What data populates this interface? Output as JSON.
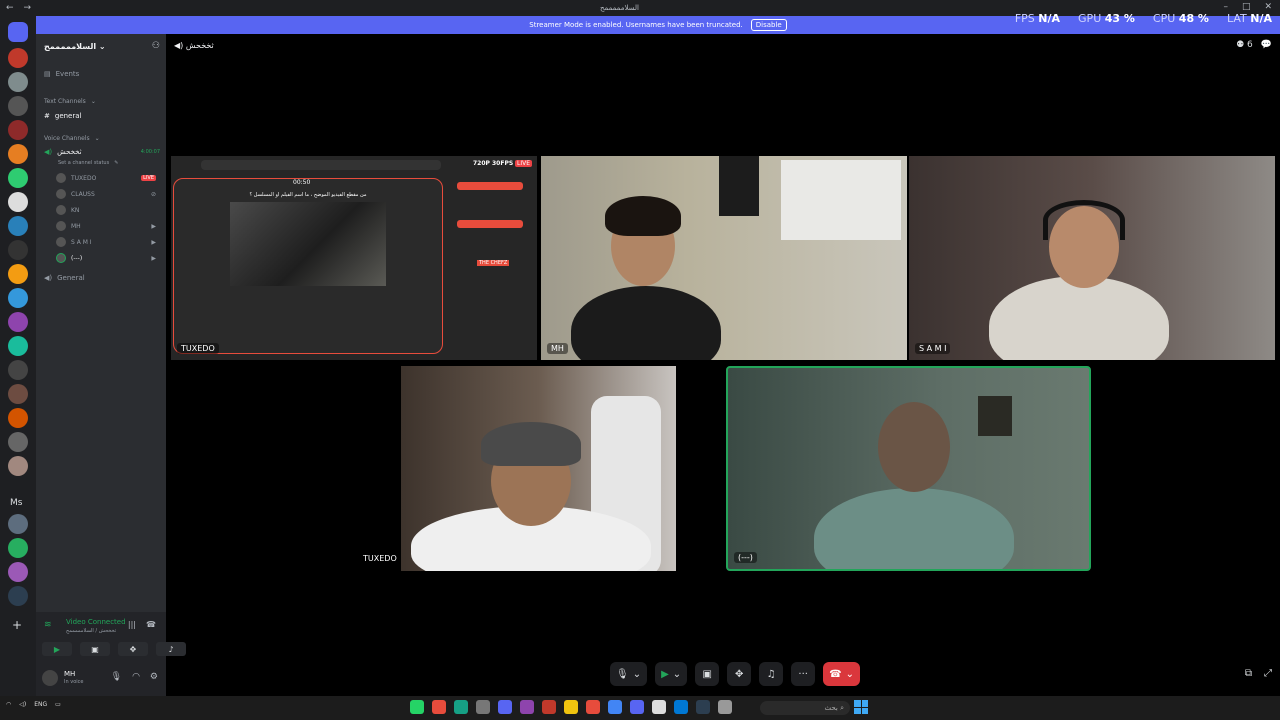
{
  "window": {
    "title": "السلامممممح"
  },
  "overlay": {
    "fps_label": "FPS",
    "fps_value": "N/A",
    "gpu_label": "GPU",
    "gpu_value": "43 %",
    "cpu_label": "CPU",
    "cpu_value": "48 %",
    "lat_label": "LAT",
    "lat_value": "N/A"
  },
  "banner": {
    "text": "Streamer Mode is enabled. Usernames have been truncated.",
    "button": "Disable"
  },
  "server": {
    "name": "السلامممممح"
  },
  "sidebar": {
    "events": "Events",
    "text_category": "Text Channels",
    "text_channel": "general",
    "voice_category": "Voice Channels",
    "voice_channel": "ثخخحش",
    "voice_timer": "4:00:07",
    "voice_status": "Set a channel status",
    "users": [
      {
        "name": "TUXEDO",
        "live": "LIVE"
      },
      {
        "name": "CLAUSS"
      },
      {
        "name": "KN"
      },
      {
        "name": "MH"
      },
      {
        "name": "S A M I"
      },
      {
        "name": "(---)"
      }
    ],
    "general_voice": "General"
  },
  "voice_panel": {
    "title": "Video Connected",
    "subtitle": "ثخخحش / السلامممممح"
  },
  "user_panel": {
    "name": "MH",
    "status": "In voice"
  },
  "main": {
    "channel": "ثخخحش",
    "member_count": "6"
  },
  "tiles": {
    "stream_label": "TUXEDO",
    "stream_quality": "720P 30FPS",
    "stream_live": "LIVE",
    "stream_question": "من مقطع الفيديو الموضح ، ما اسم الفيلم او المسلسل ؟",
    "stream_time": "00:50",
    "stream_chef": "THE CHEFZ",
    "mh_label": "MH",
    "sami_label": "S A M I",
    "tuxedo_cam_label": "TUXEDO",
    "anon_label": "(---)"
  },
  "taskbar": {
    "lang": "ENG",
    "search": "بحث"
  }
}
